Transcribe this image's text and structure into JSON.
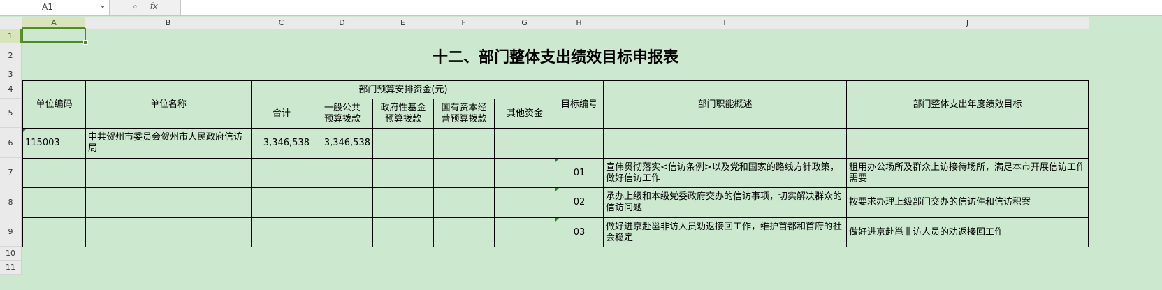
{
  "formula_bar": {
    "name_box": "A1",
    "zoom_icon": "zoom-icon",
    "fx_label": "fx",
    "formula": ""
  },
  "columns": [
    "A",
    "B",
    "C",
    "D",
    "E",
    "F",
    "G",
    "H",
    "I",
    "J"
  ],
  "rows": [
    "1",
    "2",
    "3",
    "4",
    "5",
    "6",
    "7",
    "8",
    "9",
    "10",
    "11"
  ],
  "sheet": {
    "title": "十二、部门整体支出绩效目标申报表",
    "header": {
      "unit_code": "单位编码",
      "unit_name": "单位名称",
      "budget_group": "部门预算安排资金(元)",
      "total": "合计",
      "general_public": "一般公共预算拨款",
      "gov_fund": "政府性基金预算拨款",
      "state_capital": "国有资本经营预算拨款",
      "other_funds": "其他资金",
      "target_no": "目标编号",
      "function_overview": "部门职能概述",
      "annual_target": "部门整体支出年度绩效目标"
    },
    "unit_row": {
      "code": "115003",
      "name": "中共贺州市委员会贺州市人民政府信访局",
      "total": "3,346,538",
      "general_public": "3,346,538"
    },
    "targets": [
      {
        "no": "01",
        "overview": "宣伟贯彻落实<信访条例>以及党和国家的路线方针政策，做好信访工作",
        "goal": "租用办公场所及群众上访接待场所，满足本市开展信访工作需要"
      },
      {
        "no": "02",
        "overview": "承办上级和本级党委政府交办的信访事项，切实解决群众的信访问题",
        "goal": "按要求办理上级部门交办的信访件和信访积案"
      },
      {
        "no": "03",
        "overview": "做好进京赴邕非访人员劝返接回工作，维护首都和首府的社会稳定",
        "goal": "做好进京赴邕非访人员的劝返接回工作"
      }
    ]
  }
}
